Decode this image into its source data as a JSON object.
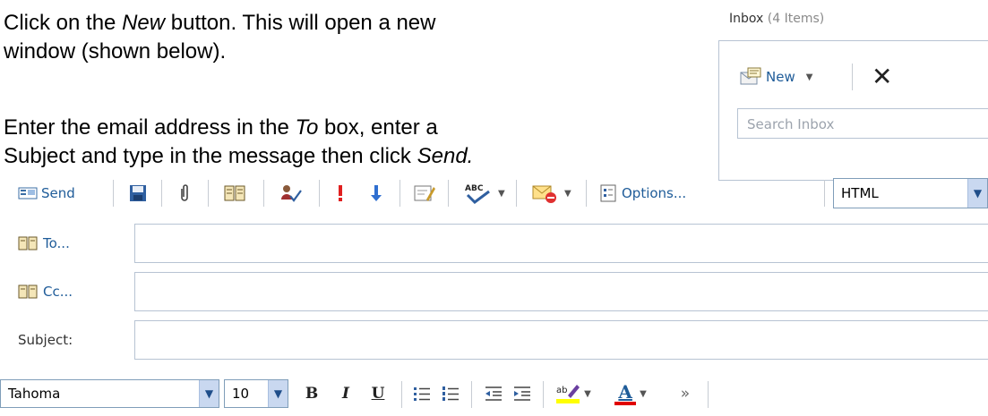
{
  "instructions": {
    "line1_pre": "Click on the ",
    "line1_em": "New",
    "line1_post": " button.  This will open a new",
    "line2": "window (shown below).",
    "line3_pre": "Enter the email address in the ",
    "line3_em": "To",
    "line3_post": " box, enter a",
    "line4_pre": "Subject and type in the message then click ",
    "line4_em": "Send."
  },
  "inbox": {
    "title": "Inbox",
    "count": "(4 Items)",
    "new_label": "New",
    "search_placeholder": "Search Inbox",
    "icons": [
      "new-mail-icon",
      "chevron-down-icon",
      "delete-icon"
    ]
  },
  "compose": {
    "toolbar": {
      "send_label": "Send",
      "options_label": "Options...",
      "format_value": "HTML",
      "icons": [
        "send-icon",
        "save-icon",
        "attach-icon",
        "address-book-icon",
        "check-names-icon",
        "high-importance-icon",
        "low-importance-icon",
        "signature-icon",
        "spelling-icon",
        "flag-icon",
        "options-icon"
      ]
    },
    "fields": {
      "to_label": "To...",
      "cc_label": "Cc...",
      "subject_label": "Subject:",
      "to_value": "",
      "cc_value": "",
      "subject_value": ""
    },
    "format_bar": {
      "font": "Tahoma",
      "size": "10",
      "bold": "B",
      "italic": "I",
      "underline": "U",
      "font_color_glyph": "A",
      "more": "»",
      "icons": [
        "bullets-icon",
        "numbering-icon",
        "decrease-indent-icon",
        "increase-indent-icon",
        "highlight-icon",
        "font-color-icon",
        "more-icon"
      ]
    }
  },
  "colors": {
    "link_blue": "#1f5c99",
    "border": "#b7c3d3",
    "highlight": "#ffff00",
    "font_red": "#e00000"
  }
}
